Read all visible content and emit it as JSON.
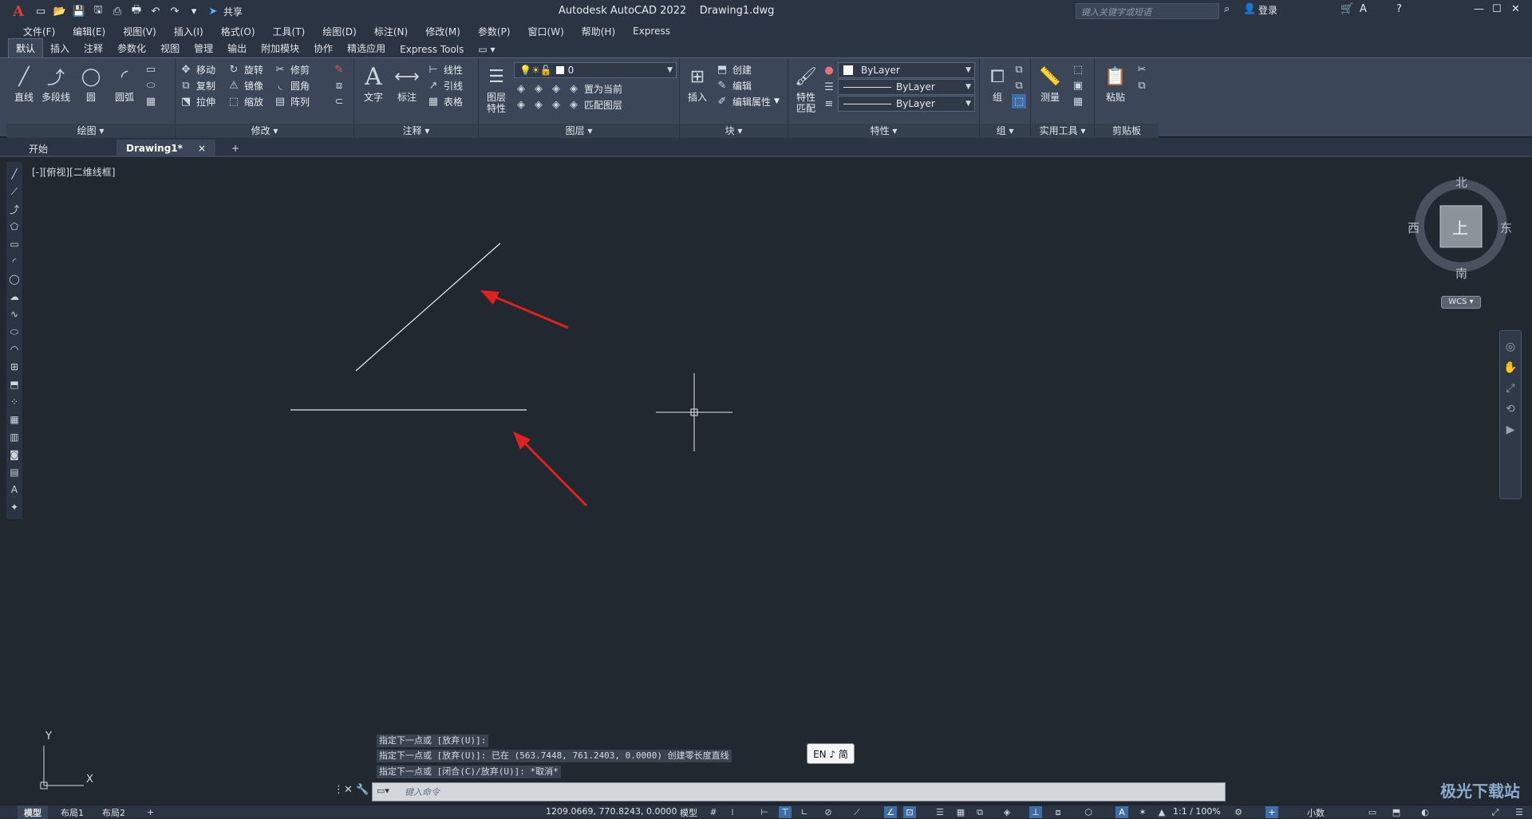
{
  "app": {
    "title": "Autodesk AutoCAD 2022    Drawing1.dwg",
    "share": "共享",
    "search_placeholder": "键入关键字或短语",
    "login": "登录"
  },
  "menu": [
    "文件(F)",
    "编辑(E)",
    "视图(V)",
    "插入(I)",
    "格式(O)",
    "工具(T)",
    "绘图(D)",
    "标注(N)",
    "修改(M)",
    "参数(P)",
    "窗口(W)",
    "帮助(H)",
    "Express"
  ],
  "ribbon_tabs": [
    "默认",
    "插入",
    "注释",
    "参数化",
    "视图",
    "管理",
    "输出",
    "附加模块",
    "协作",
    "精选应用",
    "Express Tools"
  ],
  "ribbon": {
    "draw": {
      "title": "绘图 ▾",
      "line": "直线",
      "polyline": "多段线",
      "circle": "圆",
      "arc": "圆弧"
    },
    "modify": {
      "title": "修改 ▾",
      "move": "移动",
      "rotate": "旋转",
      "trim": "修剪",
      "copy": "复制",
      "mirror": "镜像",
      "fillet": "圆角",
      "stretch": "拉伸",
      "scale": "缩放",
      "array": "阵列"
    },
    "annotation": {
      "title": "注释 ▾",
      "text": "文字",
      "dimension": "标注",
      "linear": "线性",
      "leader": "引线",
      "table": "表格"
    },
    "layers": {
      "title": "图层 ▾",
      "layer_props": "图层\n特性",
      "current_layer": "0",
      "set_current": "置为当前",
      "match_layer": "匹配图层"
    },
    "block": {
      "title": "块 ▾",
      "insert": "插入",
      "create": "创建",
      "edit": "编辑",
      "edit_attr": "编辑属性"
    },
    "properties": {
      "title": "特性 ▾",
      "match": "特性\n匹配",
      "color": "ByLayer",
      "linetype": "ByLayer",
      "lineweight": "ByLayer"
    },
    "groups": {
      "title": "组 ▾",
      "group": "组"
    },
    "utilities": {
      "title": "实用工具 ▾",
      "measure": "测量"
    },
    "clipboard": {
      "title": "剪贴板",
      "paste": "粘贴"
    }
  },
  "doc_tabs": {
    "start": "开始",
    "drawing": "Drawing1*",
    "close": "×",
    "add": "+"
  },
  "viewport_label": "[-][俯视][二维线框]",
  "viewcube": {
    "north": "北",
    "south": "南",
    "east": "东",
    "west": "西",
    "top": "上",
    "wcs": "WCS"
  },
  "ucs": {
    "y": "Y",
    "x": "X"
  },
  "command_history": [
    "指定下一点或 [放弃(U)]:",
    "指定下一点或 [放弃(U)]: 已在 (563.7448, 761.2403, 0.0000) 创建零长度直线",
    "指定下一点或 [闭合(C)/放弃(U)]: *取消*"
  ],
  "command_placeholder": "键入命令",
  "ime": "EN ♪ 简",
  "layout_tabs": [
    "模型",
    "布局1",
    "布局2"
  ],
  "status": {
    "coords": "1209.0669, 770.8243, 0.0000",
    "model": "模型",
    "scale": "1:1 / 100%",
    "units": "小数"
  },
  "watermark": "极光下载站",
  "colors": {
    "canvas": "#212830",
    "ribbon": "#3b4758",
    "arrow": "#e0201f",
    "accent": "#3d6ea8"
  }
}
